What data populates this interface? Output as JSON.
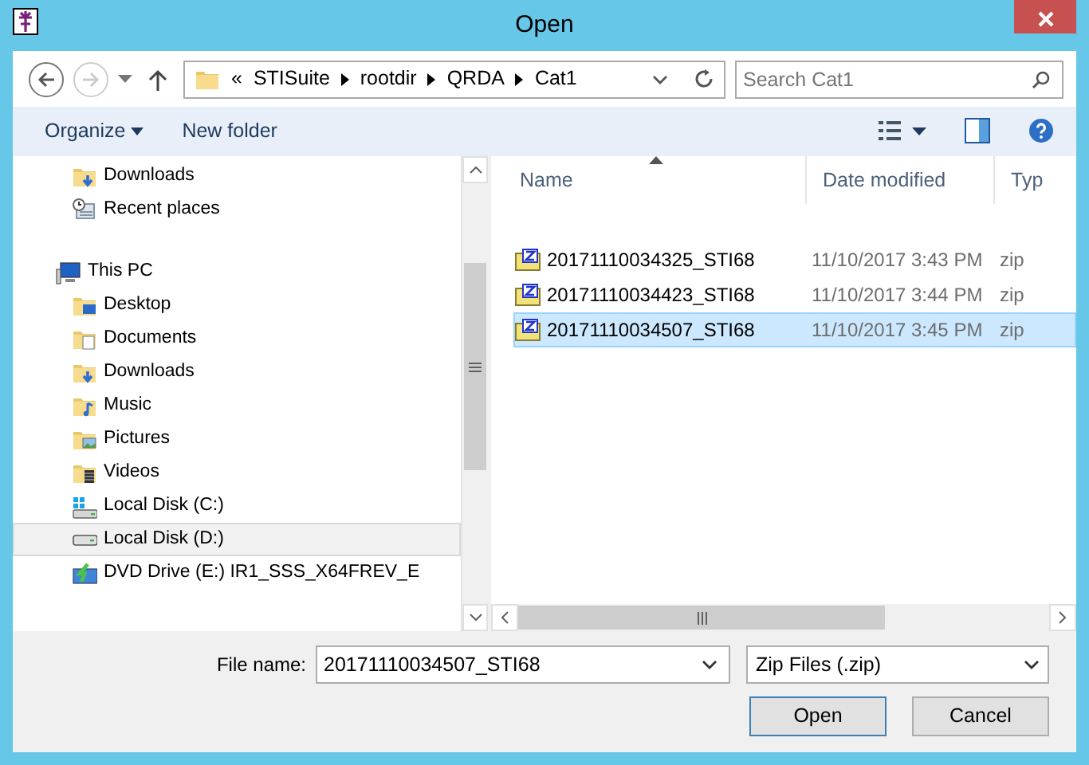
{
  "window": {
    "title": "Open"
  },
  "address": {
    "segments": [
      "STISuite",
      "rootdir",
      "QRDA",
      "Cat1"
    ],
    "overflow": "«"
  },
  "search": {
    "placeholder": "Search Cat1"
  },
  "toolbar": {
    "organize": "Organize",
    "new_folder": "New folder"
  },
  "sidebar": {
    "quick_items": [
      {
        "label": "Downloads",
        "kind": "downloads",
        "selected": false
      },
      {
        "label": "Recent places",
        "kind": "recent",
        "selected": false
      }
    ],
    "tree": [
      {
        "label": "This PC",
        "kind": "pc",
        "selected": false,
        "children": [
          {
            "label": "Desktop",
            "kind": "desktop",
            "selected": false
          },
          {
            "label": "Documents",
            "kind": "documents",
            "selected": false
          },
          {
            "label": "Downloads",
            "kind": "downloads",
            "selected": false
          },
          {
            "label": "Music",
            "kind": "music",
            "selected": false
          },
          {
            "label": "Pictures",
            "kind": "pictures",
            "selected": false
          },
          {
            "label": "Videos",
            "kind": "videos",
            "selected": false
          },
          {
            "label": "Local Disk (C:)",
            "kind": "system-disk",
            "selected": false
          },
          {
            "label": "Local Disk (D:)",
            "kind": "disk",
            "selected": true
          },
          {
            "label": "DVD Drive (E:) IR1_SSS_X64FREV_E",
            "kind": "dvd",
            "selected": false
          }
        ]
      }
    ]
  },
  "table": {
    "columns": [
      {
        "label": "Name",
        "sorted": true
      },
      {
        "label": "Date modified",
        "sorted": false
      },
      {
        "label": "Typ",
        "sorted": false
      }
    ],
    "rows": [
      {
        "name": "20171110034325_STI68",
        "date": "11/10/2017 3:43 PM",
        "type": "zip",
        "selected": false
      },
      {
        "name": "20171110034423_STI68",
        "date": "11/10/2017 3:44 PM",
        "type": "zip",
        "selected": false
      },
      {
        "name": "20171110034507_STI68",
        "date": "11/10/2017 3:45 PM",
        "type": "zip",
        "selected": true
      }
    ]
  },
  "footer": {
    "file_name_label": "File name:",
    "file_name": "20171110034507_STI68",
    "file_type": "Zip Files (.zip)",
    "buttons": [
      {
        "label": "Open",
        "kind": "default"
      },
      {
        "label": "Cancel",
        "kind": "normal"
      }
    ]
  }
}
